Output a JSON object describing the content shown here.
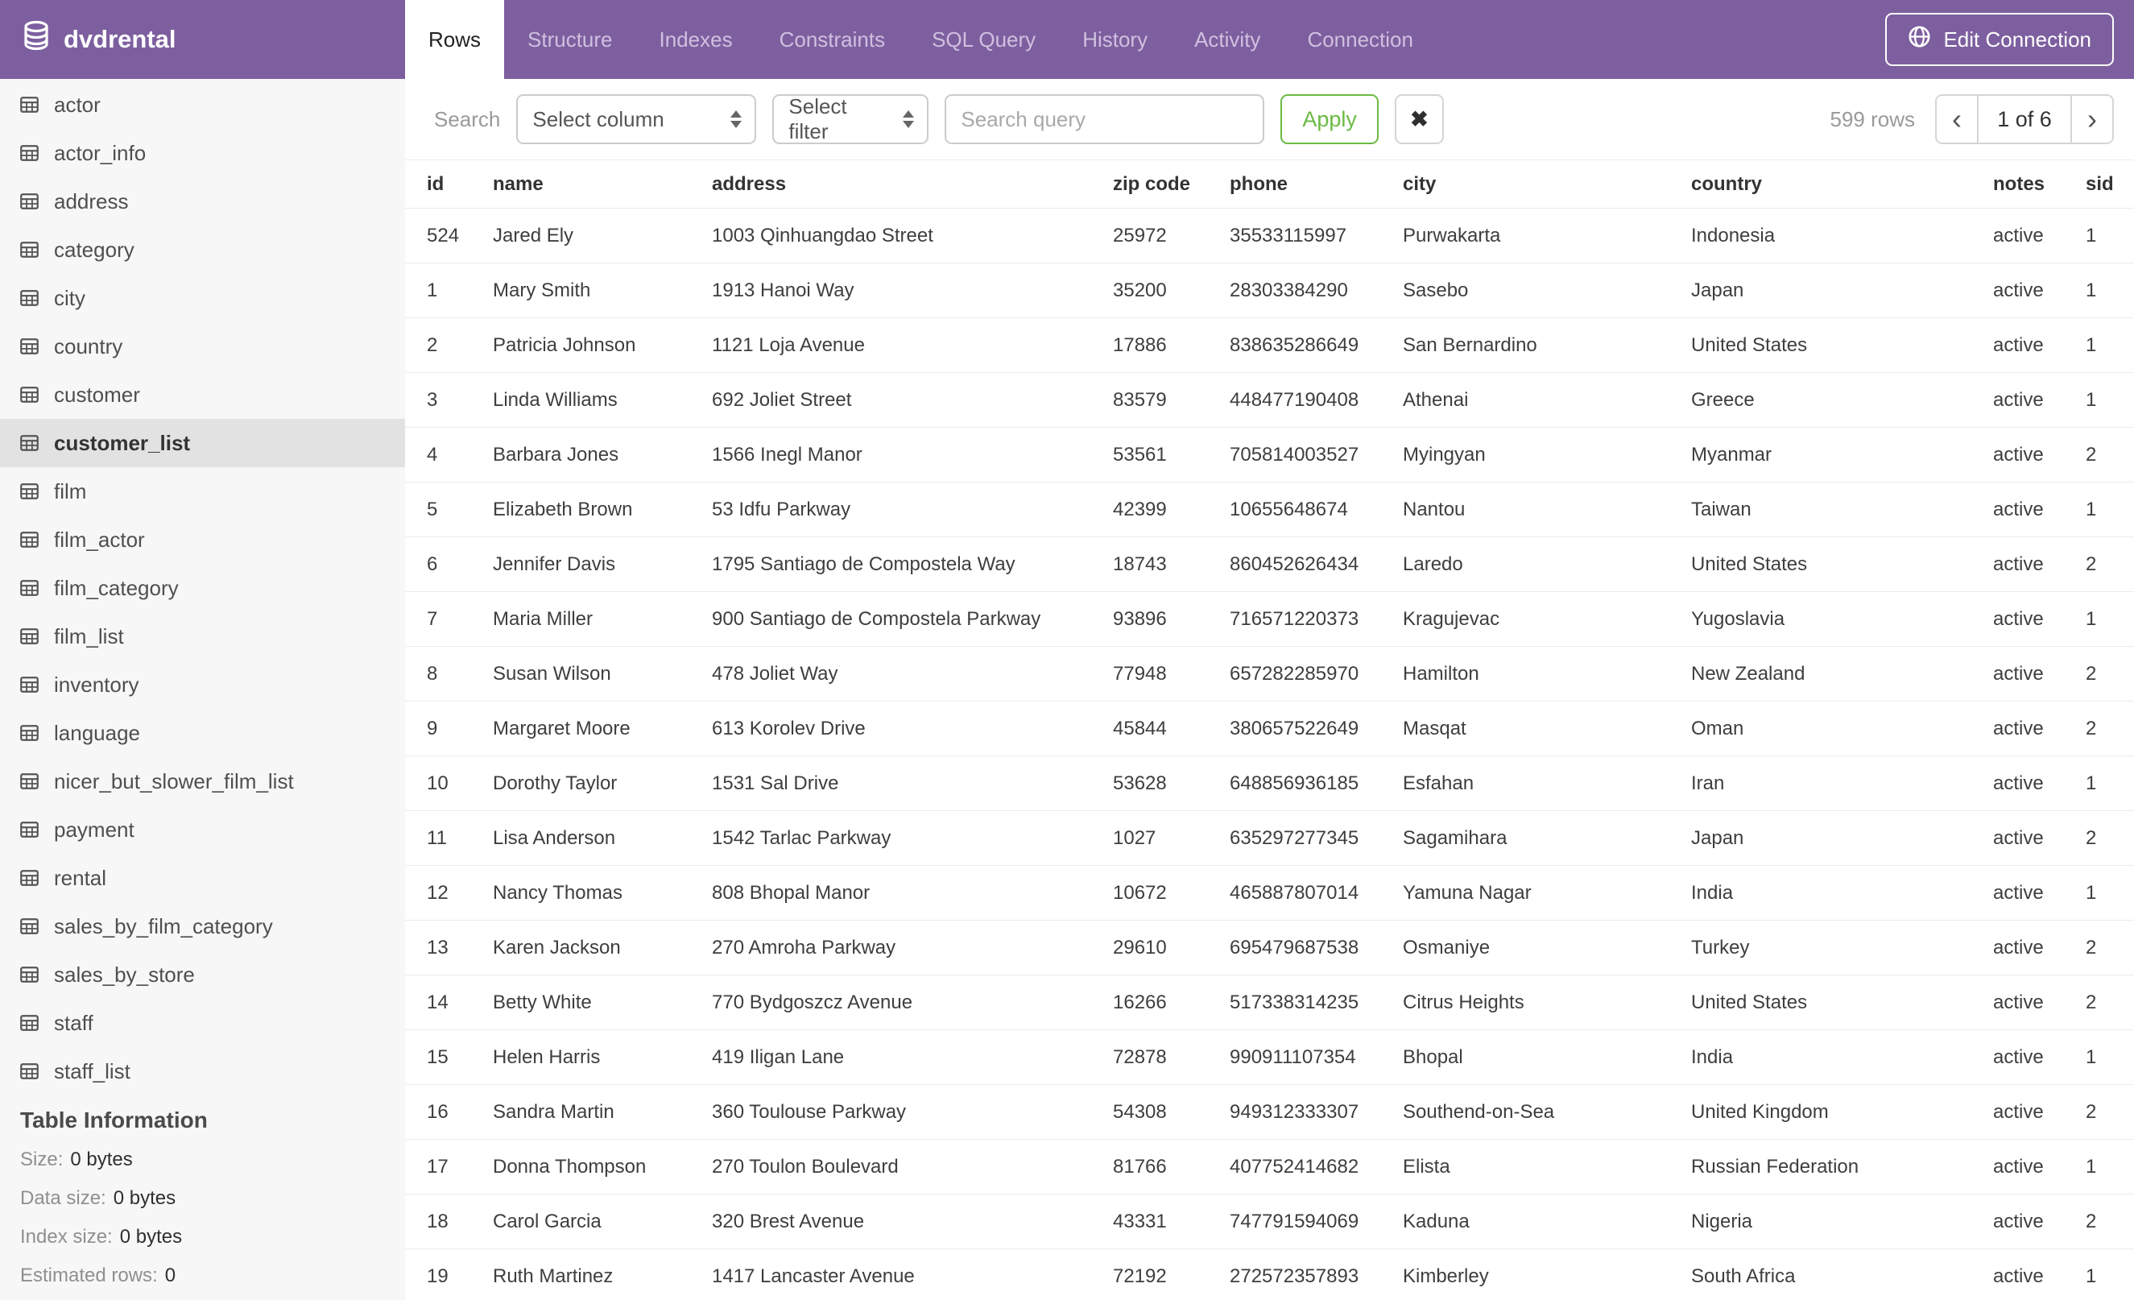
{
  "header": {
    "app_title": "dvdrental",
    "tabs": [
      {
        "label": "Rows",
        "active": true
      },
      {
        "label": "Structure",
        "active": false
      },
      {
        "label": "Indexes",
        "active": false
      },
      {
        "label": "Constraints",
        "active": false
      },
      {
        "label": "SQL Query",
        "active": false
      },
      {
        "label": "History",
        "active": false
      },
      {
        "label": "Activity",
        "active": false
      },
      {
        "label": "Connection",
        "active": false
      }
    ],
    "edit_connection_label": "Edit Connection"
  },
  "sidebar": {
    "tables": [
      "actor",
      "actor_info",
      "address",
      "category",
      "city",
      "country",
      "customer",
      "customer_list",
      "film",
      "film_actor",
      "film_category",
      "film_list",
      "inventory",
      "language",
      "nicer_but_slower_film_list",
      "payment",
      "rental",
      "sales_by_film_category",
      "sales_by_store",
      "staff",
      "staff_list"
    ],
    "selected": "customer_list",
    "table_information": {
      "heading": "Table Information",
      "rows": [
        {
          "label": "Size:",
          "value": "0 bytes"
        },
        {
          "label": "Data size:",
          "value": "0 bytes"
        },
        {
          "label": "Index size:",
          "value": "0 bytes"
        },
        {
          "label": "Estimated rows:",
          "value": "0"
        }
      ]
    }
  },
  "toolbar": {
    "search_label": "Search",
    "column_select_value": "Select column",
    "filter_select_value": "Select filter",
    "query_placeholder": "Search query",
    "apply_label": "Apply",
    "clear_glyph": "✖",
    "row_count": "599 rows",
    "pagination": {
      "prev_glyph": "‹",
      "current": "1 of 6",
      "next_glyph": "›"
    }
  },
  "table": {
    "columns": [
      "id",
      "name",
      "address",
      "zip code",
      "phone",
      "city",
      "country",
      "notes",
      "sid"
    ],
    "rows": [
      [
        "524",
        "Jared Ely",
        "1003 Qinhuangdao Street",
        "25972",
        "35533115997",
        "Purwakarta",
        "Indonesia",
        "active",
        "1"
      ],
      [
        "1",
        "Mary Smith",
        "1913 Hanoi Way",
        "35200",
        "28303384290",
        "Sasebo",
        "Japan",
        "active",
        "1"
      ],
      [
        "2",
        "Patricia Johnson",
        "1121 Loja Avenue",
        "17886",
        "838635286649",
        "San Bernardino",
        "United States",
        "active",
        "1"
      ],
      [
        "3",
        "Linda Williams",
        "692 Joliet Street",
        "83579",
        "448477190408",
        "Athenai",
        "Greece",
        "active",
        "1"
      ],
      [
        "4",
        "Barbara Jones",
        "1566 Inegl Manor",
        "53561",
        "705814003527",
        "Myingyan",
        "Myanmar",
        "active",
        "2"
      ],
      [
        "5",
        "Elizabeth Brown",
        "53 Idfu Parkway",
        "42399",
        "10655648674",
        "Nantou",
        "Taiwan",
        "active",
        "1"
      ],
      [
        "6",
        "Jennifer Davis",
        "1795 Santiago de Compostela Way",
        "18743",
        "860452626434",
        "Laredo",
        "United States",
        "active",
        "2"
      ],
      [
        "7",
        "Maria Miller",
        "900 Santiago de Compostela Parkway",
        "93896",
        "716571220373",
        "Kragujevac",
        "Yugoslavia",
        "active",
        "1"
      ],
      [
        "8",
        "Susan Wilson",
        "478 Joliet Way",
        "77948",
        "657282285970",
        "Hamilton",
        "New Zealand",
        "active",
        "2"
      ],
      [
        "9",
        "Margaret Moore",
        "613 Korolev Drive",
        "45844",
        "380657522649",
        "Masqat",
        "Oman",
        "active",
        "2"
      ],
      [
        "10",
        "Dorothy Taylor",
        "1531 Sal Drive",
        "53628",
        "648856936185",
        "Esfahan",
        "Iran",
        "active",
        "1"
      ],
      [
        "11",
        "Lisa Anderson",
        "1542 Tarlac Parkway",
        "1027",
        "635297277345",
        "Sagamihara",
        "Japan",
        "active",
        "2"
      ],
      [
        "12",
        "Nancy Thomas",
        "808 Bhopal Manor",
        "10672",
        "465887807014",
        "Yamuna Nagar",
        "India",
        "active",
        "1"
      ],
      [
        "13",
        "Karen Jackson",
        "270 Amroha Parkway",
        "29610",
        "695479687538",
        "Osmaniye",
        "Turkey",
        "active",
        "2"
      ],
      [
        "14",
        "Betty White",
        "770 Bydgoszcz Avenue",
        "16266",
        "517338314235",
        "Citrus Heights",
        "United States",
        "active",
        "2"
      ],
      [
        "15",
        "Helen Harris",
        "419 Iligan Lane",
        "72878",
        "990911107354",
        "Bhopal",
        "India",
        "active",
        "1"
      ],
      [
        "16",
        "Sandra Martin",
        "360 Toulouse Parkway",
        "54308",
        "949312333307",
        "Southend-on-Sea",
        "United Kingdom",
        "active",
        "2"
      ],
      [
        "17",
        "Donna Thompson",
        "270 Toulon Boulevard",
        "81766",
        "407752414682",
        "Elista",
        "Russian Federation",
        "active",
        "1"
      ],
      [
        "18",
        "Carol Garcia",
        "320 Brest Avenue",
        "43331",
        "747791594069",
        "Kaduna",
        "Nigeria",
        "active",
        "2"
      ],
      [
        "19",
        "Ruth Martinez",
        "1417 Lancaster Avenue",
        "72192",
        "272572357893",
        "Kimberley",
        "South Africa",
        "active",
        "1"
      ]
    ]
  },
  "colors": {
    "header_purple": "#7d5f9f",
    "inactive_tab_text": "#cfc0e0",
    "accent_green": "#6cba43",
    "sidebar_bg": "#f7f7f7",
    "selected_item_bg": "#e2e2e2",
    "row_border": "#ececec"
  }
}
